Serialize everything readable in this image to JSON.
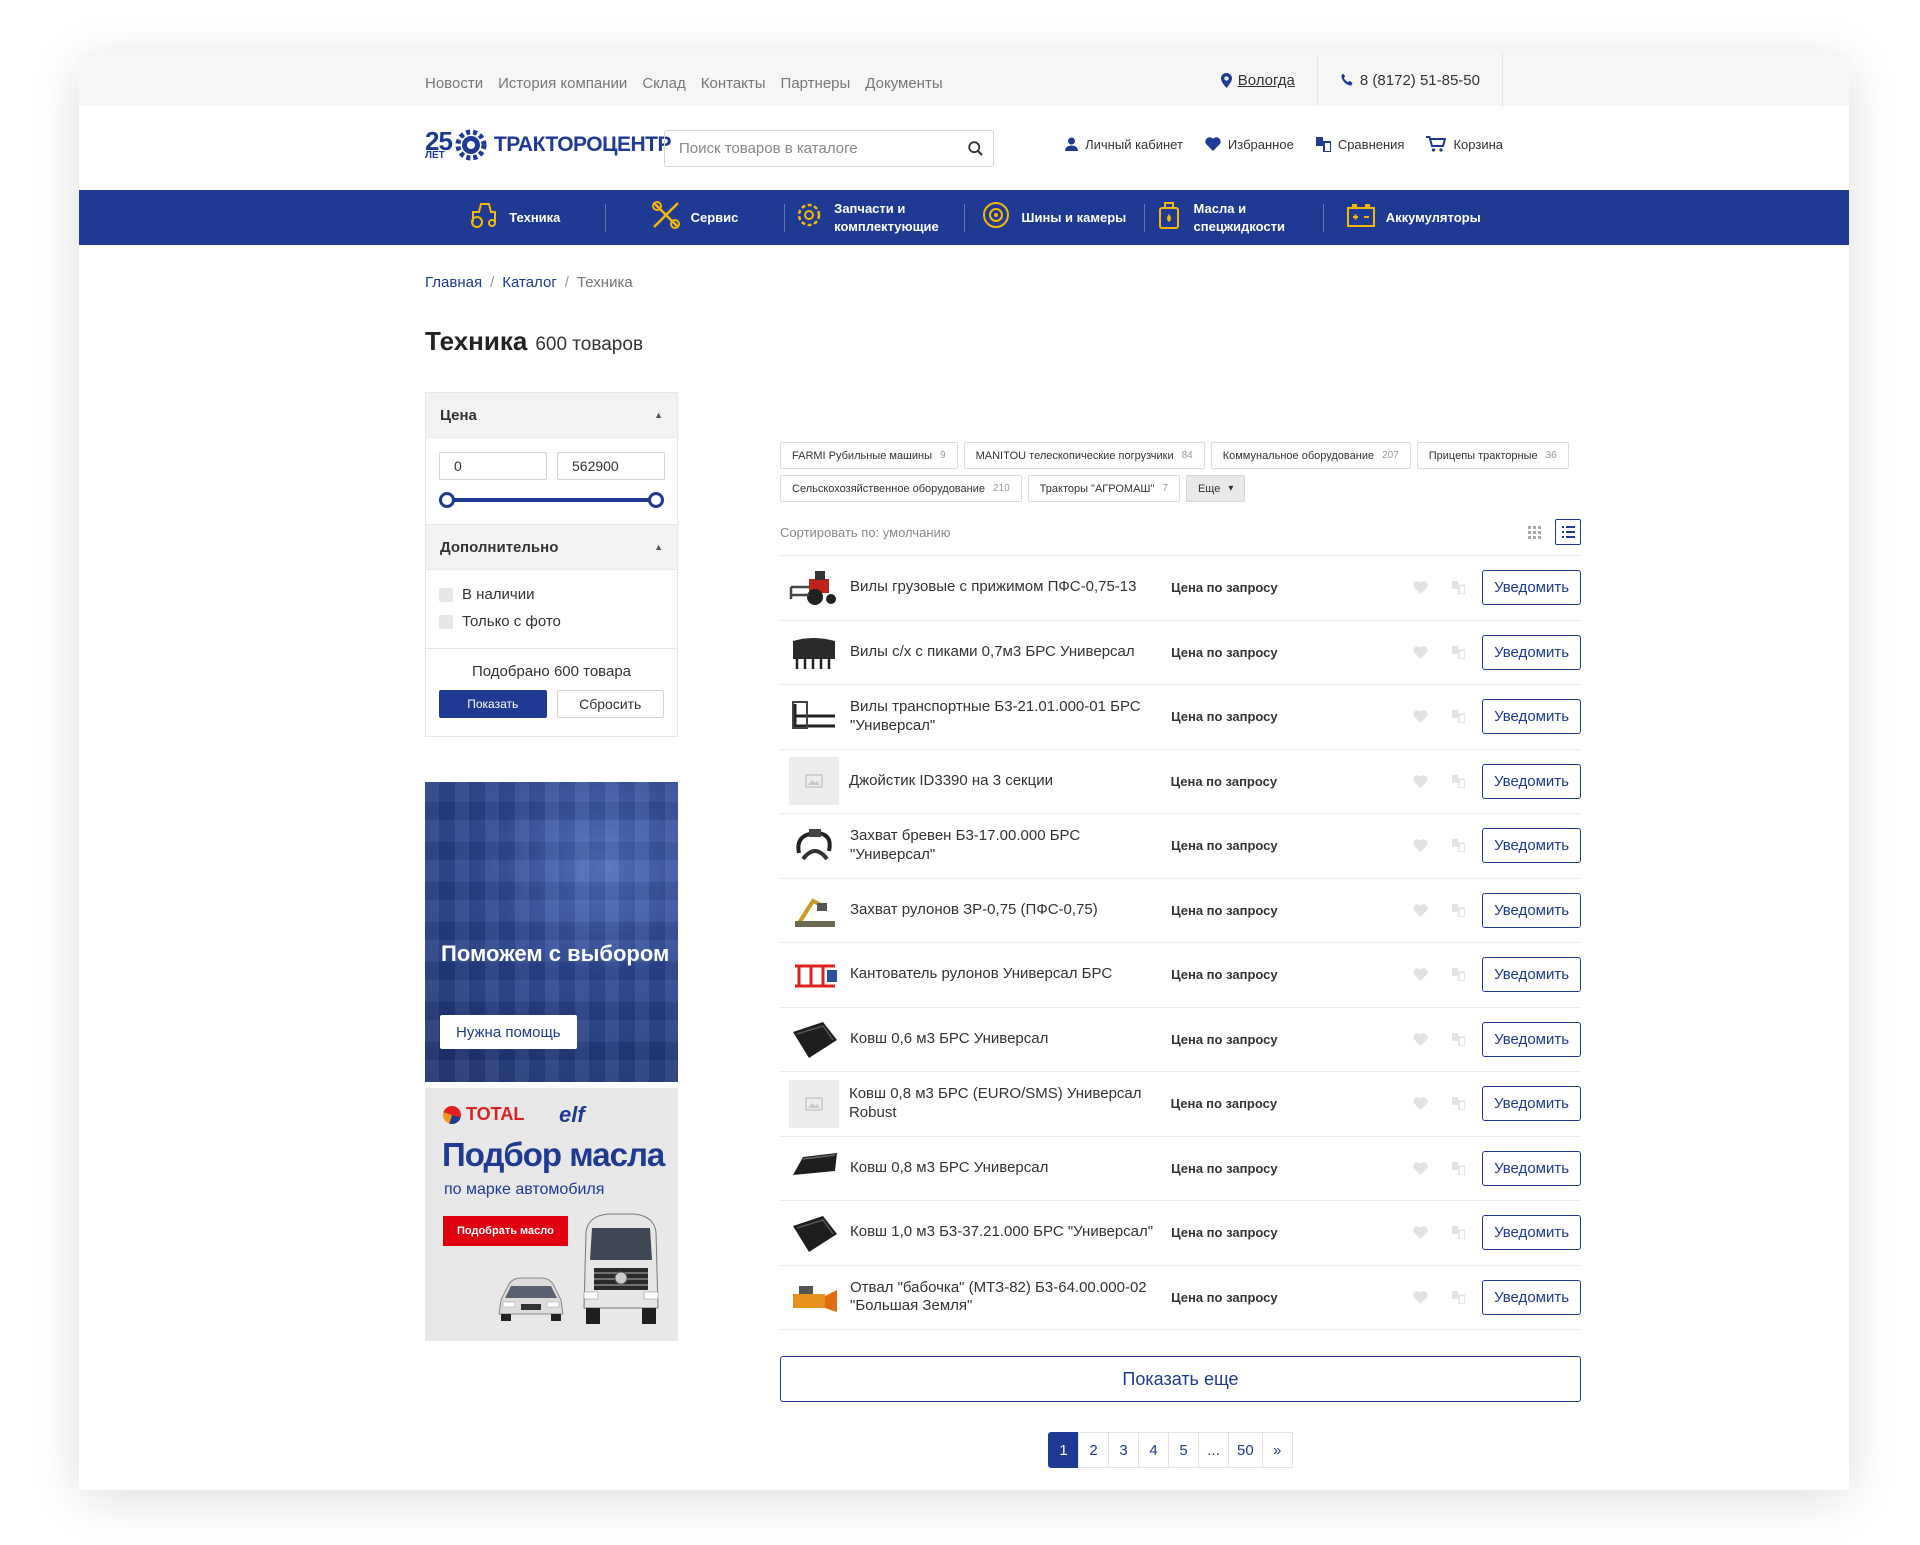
{
  "topbar": {
    "links": [
      "Новости",
      "История компании",
      "Склад",
      "Контакты",
      "Партнеры",
      "Документы"
    ],
    "city": "Вологда",
    "phone": "8 (8172) 51-85-50"
  },
  "header": {
    "logo_years": "25",
    "logo_years_label": "ЛЕТ",
    "logo_name": "ТРАКТОРОЦЕНТР",
    "search_placeholder": "Поиск товаров в каталоге",
    "actions": {
      "account": "Личный кабинет",
      "favorites": "Избранное",
      "compare": "Сравнения",
      "cart": "Корзина"
    }
  },
  "nav": [
    {
      "label": "Техника",
      "icon": "tractor-icon"
    },
    {
      "label": "Сервис",
      "icon": "tools-icon"
    },
    {
      "label": "Запчасти и комплектующие",
      "icon": "gear-icon"
    },
    {
      "label": "Шины и камеры",
      "icon": "tire-icon"
    },
    {
      "label": "Масла и спецжидкости",
      "icon": "oil-can-icon"
    },
    {
      "label": "Аккумуляторы",
      "icon": "battery-icon"
    }
  ],
  "breadcrumb": {
    "home": "Главная",
    "catalog": "Каталог",
    "current": "Техника",
    "sep": "/"
  },
  "page": {
    "title": "Техника",
    "count": "600 товаров"
  },
  "filter": {
    "price_title": "Цена",
    "price_min": "0",
    "price_max": "562900",
    "extra_title": "Дополнительно",
    "in_stock": "В наличии",
    "photo_only": "Только с фото",
    "found": "Подобрано 600 товара",
    "show": "Показать",
    "reset": "Сбросить"
  },
  "banner_help": {
    "title": "Поможем с выбором",
    "button": "Нужна помощь"
  },
  "banner_oil": {
    "brand1": "TOTAL",
    "brand2": "elf",
    "title": "Подбор масла",
    "subtitle": "по марке автомобиля",
    "button": "Подобрать масло"
  },
  "chips": [
    {
      "label": "FARMI Рубильные машины",
      "count": "9"
    },
    {
      "label": "MANITOU телескопические погрузчики",
      "count": "84"
    },
    {
      "label": "Коммунальное оборудование",
      "count": "207"
    },
    {
      "label": "Прицепы тракторные",
      "count": "36"
    },
    {
      "label": "Сельскохозяйственное оборудование",
      "count": "210"
    },
    {
      "label": "Тракторы \"АГРОМАШ\"",
      "count": "7"
    }
  ],
  "chips_more": "Еще",
  "sort": {
    "label": "Сортировать по: умолчанию"
  },
  "products": [
    {
      "name": "Вилы грузовые с прижимом ПФС-0,75-13",
      "price": "Цена по запросу",
      "thumb": "red-tractor"
    },
    {
      "name": "Вилы с/х с пиками 0,7м3 БРС Универсал",
      "price": "Цена по запросу",
      "thumb": "bucket-forks"
    },
    {
      "name": "Вилы транспортные Б3-21.01.000-01 БРС \"Универсал\"",
      "price": "Цена по запросу",
      "thumb": "pallet-forks"
    },
    {
      "name": "Джойстик ID3390 на 3 секции",
      "price": "Цена по запросу",
      "thumb": "no-photo"
    },
    {
      "name": "Захват бревен Б3-17.00.000 БРС \"Универсал\"",
      "price": "Цена по запросу",
      "thumb": "log-grab"
    },
    {
      "name": "Захват рулонов ЗР-0,75 (ПФС-0,75)",
      "price": "Цена по запросу",
      "thumb": "bale-grab"
    },
    {
      "name": "Кантователь рулонов Универсал БРС",
      "price": "Цена по запросу",
      "thumb": "bale-tipper"
    },
    {
      "name": "Ковш 0,6 м3 БРС Универсал",
      "price": "Цена по запросу",
      "thumb": "bucket"
    },
    {
      "name": "Ковш 0,8 м3 БРС (EURO/SMS) Универсал Robust",
      "price": "Цена по запросу",
      "thumb": "no-photo"
    },
    {
      "name": "Ковш 0,8 м3 БРС Универсал",
      "price": "Цена по запросу",
      "thumb": "bucket-flat"
    },
    {
      "name": "Ковш 1,0 м3 Б3-37.21.000 БРС \"Универсал\"",
      "price": "Цена по запросу",
      "thumb": "bucket"
    },
    {
      "name": "Отвал \"бабочка\" (МТЗ-82) Б3-64.00.000-02 \"Большая Земля\"",
      "price": "Цена по запросу",
      "thumb": "blade"
    }
  ],
  "notify_label": "Уведомить",
  "show_more": "Показать еще",
  "pagination": [
    "1",
    "2",
    "3",
    "4",
    "5",
    "...",
    "50",
    "»"
  ],
  "colors": {
    "brand": "#1f3a93",
    "accent_red": "#e10010"
  }
}
